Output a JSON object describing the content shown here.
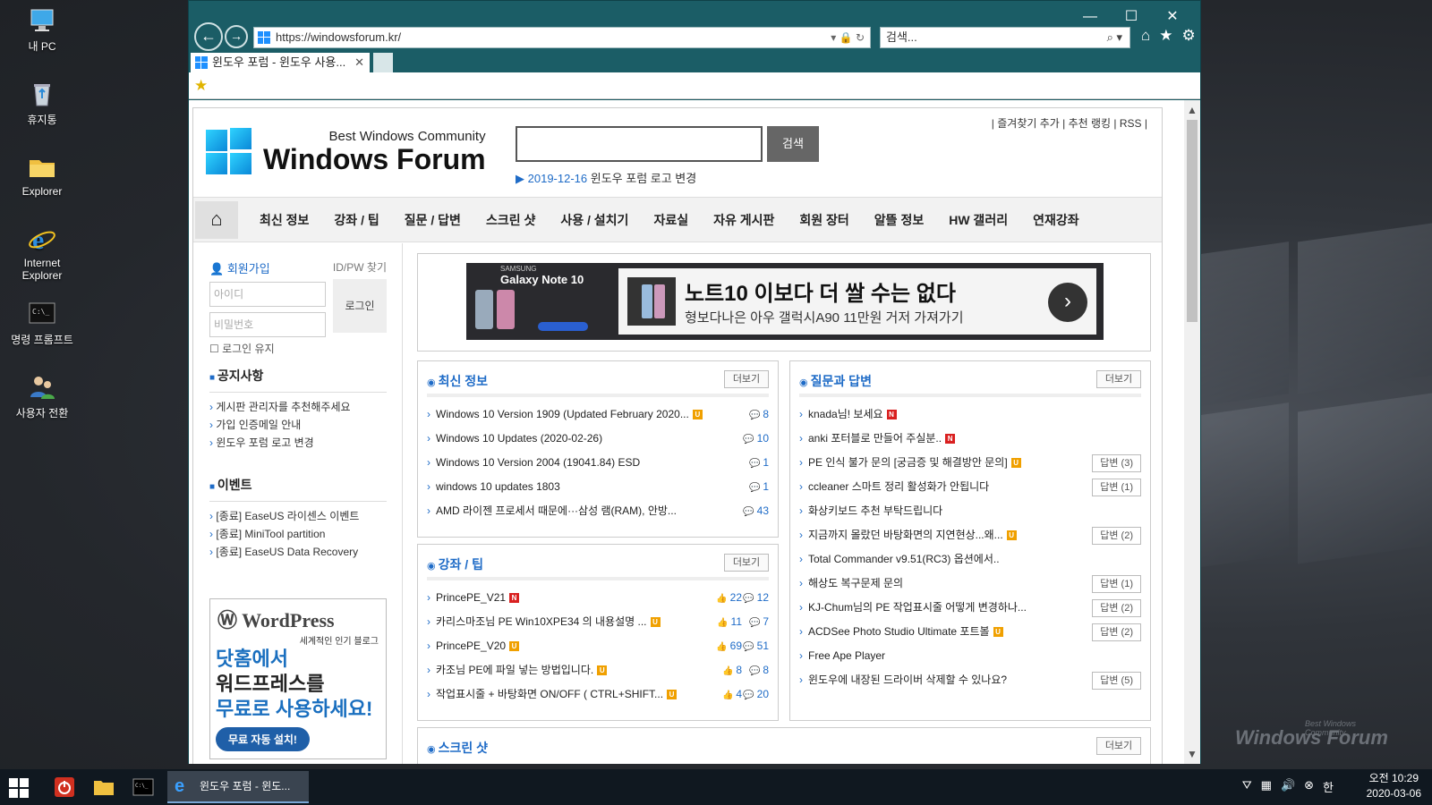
{
  "desktop": {
    "icons": [
      {
        "label": "내 PC",
        "icon": "pc-icon"
      },
      {
        "label": "휴지통",
        "icon": "recycle-bin-icon"
      },
      {
        "label": "Explorer",
        "icon": "folder-icon"
      },
      {
        "label": "Internet Explorer",
        "icon": "ie-icon"
      },
      {
        "label": "명령 프롬프트",
        "icon": "cmd-icon"
      },
      {
        "label": "사용자 전환",
        "icon": "user-switch-icon"
      }
    ],
    "watermark": "Windows Forum",
    "watermark_small": "Best Windows Community"
  },
  "browser": {
    "url": "https://windowsforum.kr/",
    "search_placeholder": "검색...",
    "tab_title": "윈도우 포럼 - 윈도우 사용...",
    "accent": "#1b5d66"
  },
  "site": {
    "logo_sub": "Best Windows Community",
    "logo_main": "Windows Forum",
    "search_button": "검색",
    "notice_date": "2019-12-16",
    "notice_text": "윈도우 포럼 로고 변경",
    "top_links": "| 즐겨찾기 추가 | 추천 랭킹 | RSS |",
    "nav": [
      "최신 정보",
      "강좌 / 팁",
      "질문 / 답변",
      "스크린 샷",
      "사용 / 설치기",
      "자료실",
      "자유 게시판",
      "회원 장터",
      "알뜰 정보",
      "HW 갤러리",
      "연재강좌"
    ],
    "login": {
      "join": "회원가입",
      "find": "ID/PW 찾기",
      "id_placeholder": "아이디",
      "pw_placeholder": "비밀번호",
      "button": "로그인",
      "keep": "로그인 유지"
    },
    "notice_section": {
      "title": "공지사항",
      "items": [
        "게시판 관리자를 추천해주세요",
        "가입 인증메일 안내",
        "윈도우 포럼 로고 변경"
      ]
    },
    "event_section": {
      "title": "이벤트",
      "items": [
        "[종료] EaseUS 라이센스 이벤트",
        "[종료] MiniTool partition",
        "[종료] EaseUS Data Recovery"
      ]
    },
    "wp_ad": {
      "brand": "WordPress",
      "tag": "세계적인 인기 블로그",
      "line1": "닷홈에서",
      "line2": "워드프레스를",
      "line3": "무료로 사용하세요!",
      "button": "무료 자동 설치!"
    },
    "banner": {
      "brand": "SAMSUNG",
      "model": "Galaxy Note 10",
      "headline": "노트10 이보다 더 쌀 수는 없다",
      "sub": "형보다나은 아우 갤럭시A90 11만원 거저 가져가기"
    },
    "more_label": "더보기",
    "latest": {
      "title": "최신 정보",
      "rows": [
        {
          "text": "Windows 10 Version 1909 (Updated February 2020...",
          "badge": "u",
          "comments": "8"
        },
        {
          "text": "Windows 10 Updates (2020-02-26)",
          "badge": "",
          "comments": "10"
        },
        {
          "text": "Windows 10 Version 2004 (19041.84) ESD",
          "badge": "",
          "comments": "1"
        },
        {
          "text": "windows 10 updates 1803",
          "badge": "",
          "comments": "1"
        },
        {
          "text": "AMD 라이젠 프로세서 때문에···삼성 램(RAM), 안방...",
          "badge": "",
          "comments": "43"
        }
      ]
    },
    "tips": {
      "title": "강좌 / 팁",
      "rows": [
        {
          "text": "PrincePE_V21",
          "badge": "n",
          "likes": "22",
          "comments": "12"
        },
        {
          "text": "카리스마조님 PE Win10XPE34 의 내용설명 ...",
          "badge": "u",
          "likes": "11",
          "comments": "7"
        },
        {
          "text": "PrincePE_V20",
          "badge": "u",
          "likes": "69",
          "comments": "51"
        },
        {
          "text": "카조님 PE에 파일 넣는 방법입니다.",
          "badge": "u",
          "likes": "8",
          "comments": "8"
        },
        {
          "text": "작업표시줄 + 바탕화면 ON/OFF ( CTRL+SHIFT...",
          "badge": "u",
          "likes": "4",
          "comments": "20"
        }
      ]
    },
    "qa": {
      "title": "질문과 답변",
      "rows": [
        {
          "text": "knada님! 보세요",
          "badge": "n",
          "answer": ""
        },
        {
          "text": "anki 포터블로 만들어 주실분..",
          "badge": "n",
          "answer": ""
        },
        {
          "text": "PE 인식 불가 문의 [궁금증 및 해결방안 문의]",
          "badge": "u",
          "answer": "답변 (3)"
        },
        {
          "text": "ccleaner 스마트 정리 활성화가 안됩니다",
          "badge": "",
          "answer": "답변 (1)"
        },
        {
          "text": "화상키보드 추천 부탁드립니다",
          "badge": "",
          "answer": ""
        },
        {
          "text": "지금까지 몰랐던 바탕화면의 지연현상...왜...",
          "badge": "u",
          "answer": "답변 (2)"
        },
        {
          "text": "Total Commander v9.51(RC3) 옵션에서..",
          "badge": "",
          "answer": ""
        },
        {
          "text": "해상도 복구문제 문의",
          "badge": "",
          "answer": "답변 (1)"
        },
        {
          "text": "KJ-Chum님의 PE 작업표시줄 어떻게 변경하나...",
          "badge": "",
          "answer": "답변 (2)"
        },
        {
          "text": "ACDSee Photo Studio Ultimate 포트볼",
          "badge": "u",
          "answer": "답변 (2)"
        },
        {
          "text": "Free Ape Player",
          "badge": "",
          "answer": ""
        },
        {
          "text": "윈도우에 내장된 드라이버 삭제할 수 있나요?",
          "badge": "",
          "answer": "답변 (5)"
        }
      ]
    },
    "screenshot": {
      "title": "스크린 샷"
    }
  },
  "taskbar": {
    "app_label": "윈도우 포럼 - 윈도...",
    "time": "오전 10:29",
    "date": "2020-03-06",
    "ime": "한"
  }
}
